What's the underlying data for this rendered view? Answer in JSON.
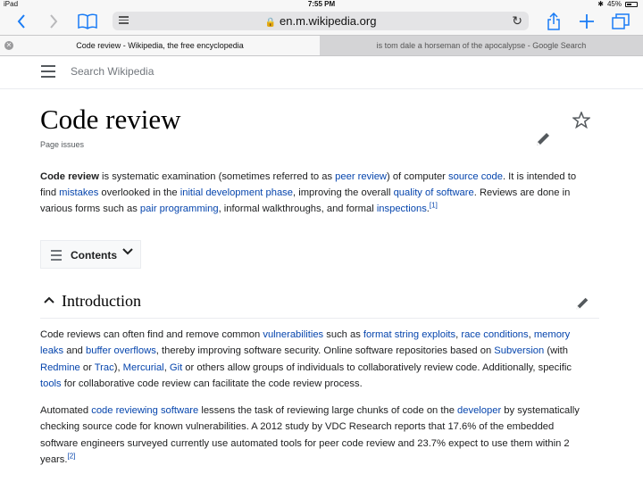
{
  "status": {
    "device": "iPad",
    "time": "7:55 PM",
    "battery": "45%"
  },
  "browser": {
    "url": "en.m.wikipedia.org",
    "tabs": [
      {
        "title": "Code review - Wikipedia, the free encyclopedia",
        "active": true
      },
      {
        "title": "is tom dale a horseman of the apocalypse - Google Search",
        "active": false
      }
    ]
  },
  "wiki": {
    "search_placeholder": "Search Wikipedia",
    "title": "Code review",
    "page_issues": "Page issues",
    "lead": [
      {
        "t": "Code review",
        "b": true
      },
      {
        "t": " is systematic examination (sometimes referred to as "
      },
      {
        "t": "peer review",
        "link": true
      },
      {
        "t": ") of computer "
      },
      {
        "t": "source code",
        "link": true
      },
      {
        "t": ". It is intended to find "
      },
      {
        "t": "mistakes",
        "link": true
      },
      {
        "t": " overlooked in the "
      },
      {
        "t": "initial development phase",
        "link": true
      },
      {
        "t": ", improving the overall "
      },
      {
        "t": "quality of software",
        "link": true
      },
      {
        "t": ". Reviews are done in various forms such as "
      },
      {
        "t": "pair programming",
        "link": true
      },
      {
        "t": ", informal walkthroughs, and formal "
      },
      {
        "t": "inspections",
        "link": true
      },
      {
        "t": ".",
        "nospace": true
      },
      {
        "t": "[1]",
        "sup": true,
        "link": true
      }
    ],
    "toc_label": "Contents",
    "section_title": "Introduction",
    "para1": [
      {
        "t": "Code reviews can often find and remove common "
      },
      {
        "t": "vulnerabilities",
        "link": true
      },
      {
        "t": " such as "
      },
      {
        "t": "format string exploits",
        "link": true
      },
      {
        "t": ", "
      },
      {
        "t": "race conditions",
        "link": true
      },
      {
        "t": ", "
      },
      {
        "t": "memory leaks",
        "link": true
      },
      {
        "t": " and "
      },
      {
        "t": "buffer overflows",
        "link": true
      },
      {
        "t": ", thereby improving software security. Online software repositories based on "
      },
      {
        "t": "Subversion",
        "link": true
      },
      {
        "t": " (with "
      },
      {
        "t": "Redmine",
        "link": true
      },
      {
        "t": " or "
      },
      {
        "t": "Trac",
        "link": true
      },
      {
        "t": "), "
      },
      {
        "t": "Mercurial",
        "link": true
      },
      {
        "t": ", "
      },
      {
        "t": "Git",
        "link": true
      },
      {
        "t": " or others allow groups of individuals to collaboratively review code. Additionally, specific "
      },
      {
        "t": "tools",
        "link": true
      },
      {
        "t": " for collaborative code review can facilitate the code review process."
      }
    ],
    "para2": [
      {
        "t": "Automated "
      },
      {
        "t": "code reviewing software",
        "link": true
      },
      {
        "t": " lessens the task of reviewing large chunks of code on the "
      },
      {
        "t": "developer",
        "link": true
      },
      {
        "t": " by systematically checking source code for known vulnerabilities. A 2012 study by VDC Research reports that 17.6% of the embedded software engineers surveyed currently use automated tools for peer code review and 23.7% expect to use them within 2 years."
      },
      {
        "t": "[2]",
        "sup": true,
        "link": true
      }
    ]
  },
  "colors": {
    "link": "#0645ad",
    "ios_blue": "#1a7cf5",
    "text": "#202122"
  }
}
